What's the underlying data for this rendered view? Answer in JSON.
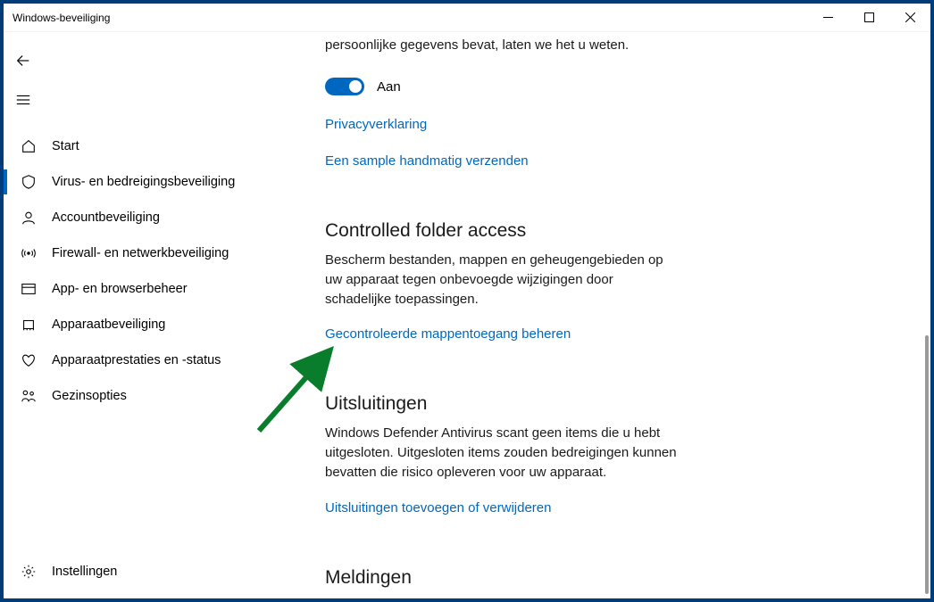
{
  "window": {
    "title": "Windows-beveiliging"
  },
  "sidebar": {
    "items": [
      {
        "label": "Start"
      },
      {
        "label": "Virus- en bedreigingsbeveiliging"
      },
      {
        "label": "Accountbeveiliging"
      },
      {
        "label": "Firewall- en netwerkbeveiliging"
      },
      {
        "label": "App- en browserbeheer"
      },
      {
        "label": "Apparaatbeveiliging"
      },
      {
        "label": "Apparaatprestaties en -status"
      },
      {
        "label": "Gezinsopties"
      }
    ],
    "settings": "Instellingen"
  },
  "main": {
    "top_desc": "persoonlijke gegevens bevat, laten we het u weten.",
    "toggle_label": "Aan",
    "link_privacy": "Privacyverklaring",
    "link_sample": "Een sample handmatig verzenden",
    "cfa": {
      "title": "Controlled folder access",
      "desc": "Bescherm bestanden, mappen en geheugengebieden op uw apparaat tegen onbevoegde wijzigingen door schadelijke toepassingen.",
      "link": "Gecontroleerde mappentoegang beheren"
    },
    "excl": {
      "title": "Uitsluitingen",
      "desc": "Windows Defender Antivirus scant geen items die u hebt uitgesloten. Uitgesloten items zouden bedreigingen kunnen bevatten die risico opleveren voor uw apparaat.",
      "link": "Uitsluitingen toevoegen of verwijderen"
    },
    "next_title": "Meldingen"
  }
}
